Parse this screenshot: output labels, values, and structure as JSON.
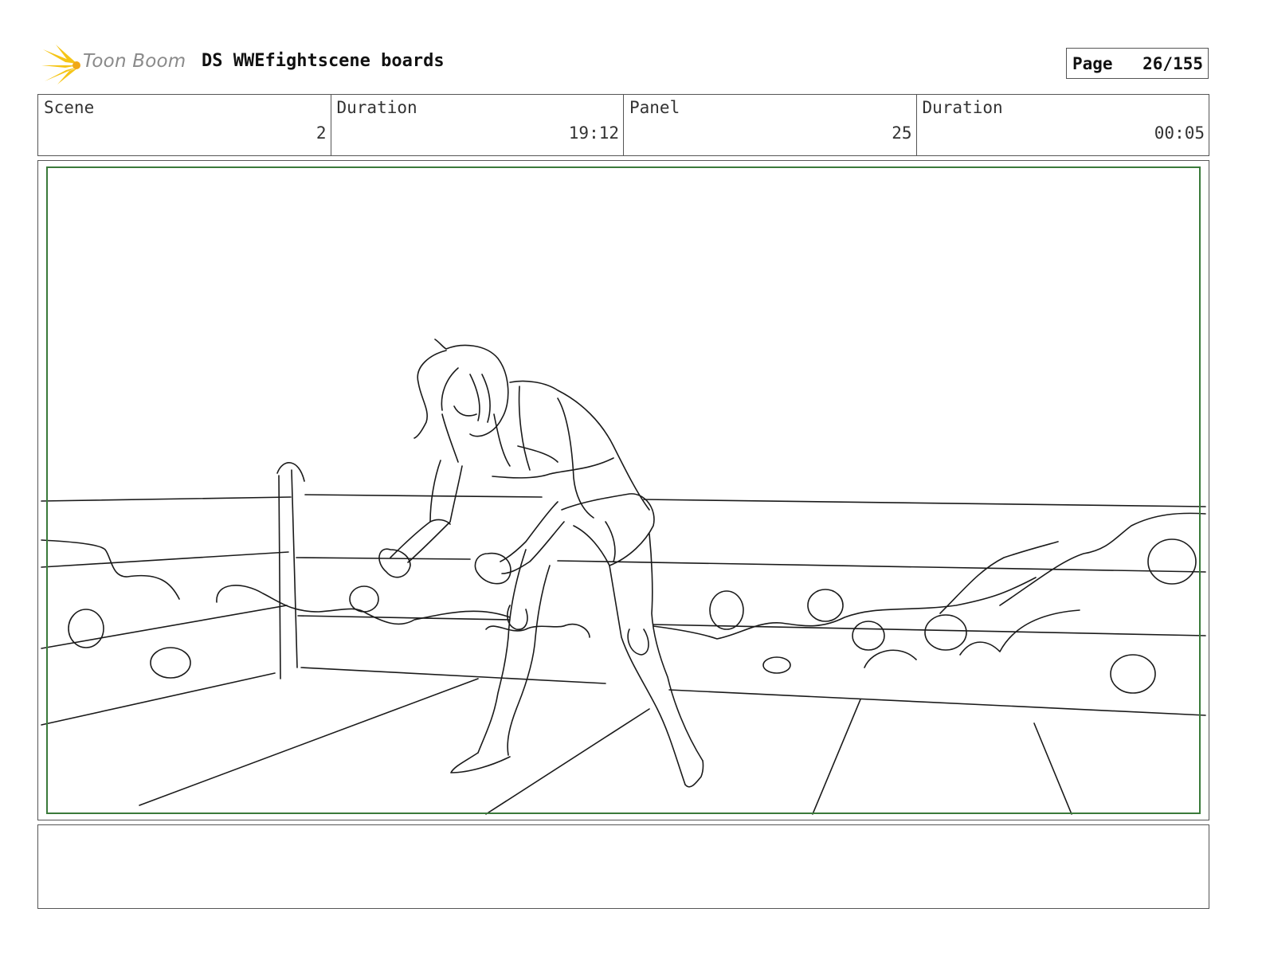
{
  "header": {
    "logo_text": "Toon Boom",
    "title": "DS WWEfightscene boards",
    "page_label": "Page",
    "page_value": "26/155"
  },
  "info": [
    {
      "label": "Scene",
      "value": "2"
    },
    {
      "label": "Duration",
      "value": "19:12"
    },
    {
      "label": "Panel",
      "value": "25"
    },
    {
      "label": "Duration",
      "value": "00:05"
    }
  ],
  "notes": {
    "text": ""
  },
  "colors": {
    "safe_area": "#3a7a3a",
    "logo_flare": "#f5c518"
  }
}
